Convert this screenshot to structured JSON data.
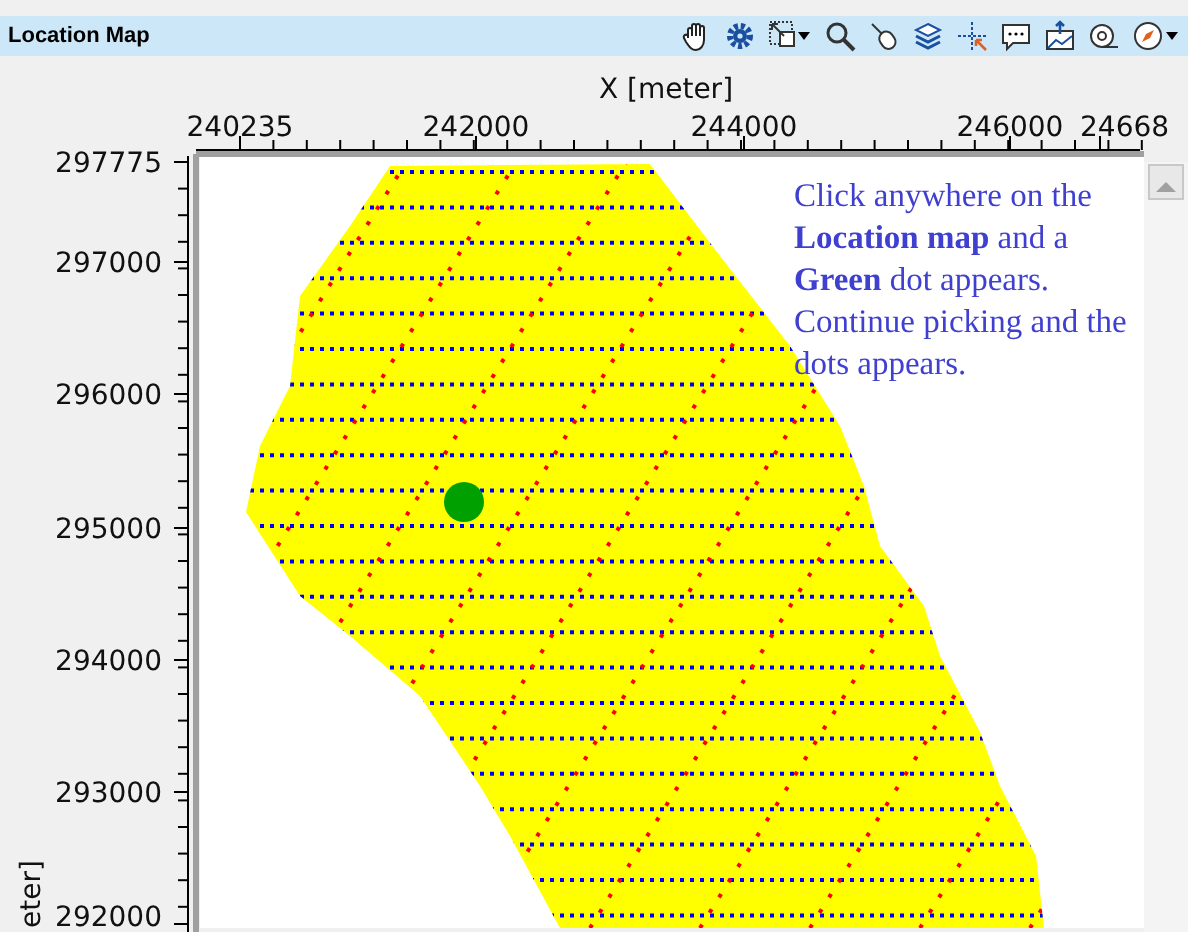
{
  "panel": {
    "title": "Location Map"
  },
  "map": {
    "x_axis": {
      "label": "X [meter]",
      "ticks": [
        "240235",
        "242000",
        "244000",
        "246000",
        "24668"
      ]
    },
    "y_axis": {
      "label": "eter]",
      "ticks": [
        "297775",
        "297000",
        "296000",
        "295000",
        "294000",
        "293000",
        "292000"
      ]
    },
    "note": "Click anywhere on the **Location map** and a **Green** dot appears. Continue picking and the dots appears."
  }
}
